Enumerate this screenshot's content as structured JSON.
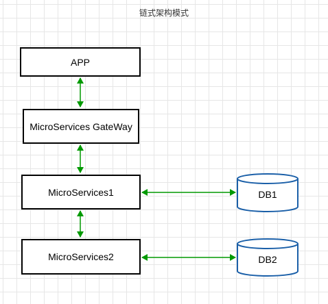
{
  "title": "链式架构模式",
  "nodes": {
    "app": "APP",
    "gateway": "MicroServices GateWay",
    "ms1": "MicroServices1",
    "ms2": "MicroServices2",
    "db1": "DB1",
    "db2": "DB2"
  },
  "colors": {
    "arrow": "#009900",
    "database_stroke": "#1a5fa8",
    "box_stroke": "#000000"
  }
}
